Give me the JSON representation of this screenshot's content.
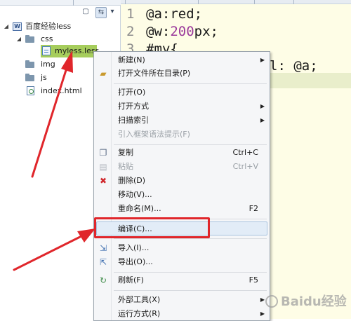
{
  "project_tree": {
    "project": "百度经验less",
    "css_folder": "css",
    "selected_file": "myless.less",
    "img_folder": "img",
    "js_folder": "js",
    "index_file": "index.html"
  },
  "editor": {
    "lines": [
      {
        "num": "1",
        "text": "@a:red;"
      },
      {
        "num": "2",
        "text_pre": "@w:",
        "text_num": "200",
        "text_post": "px;"
      },
      {
        "num": "3",
        "text": "#my{"
      },
      {
        "partial": "l: @a;"
      }
    ]
  },
  "context_menu": {
    "items": [
      {
        "label": "新建(N)",
        "shortcut": "",
        "submenu": true,
        "icon": ""
      },
      {
        "label": "打开文件所在目录(P)",
        "shortcut": "",
        "submenu": false,
        "icon": "folder-open-icon"
      },
      {
        "label": "打开(O)",
        "shortcut": "",
        "submenu": false,
        "icon": ""
      },
      {
        "label": "打开方式",
        "shortcut": "",
        "submenu": true,
        "icon": ""
      },
      {
        "label": "扫描索引",
        "shortcut": "",
        "submenu": true,
        "icon": ""
      },
      {
        "label": "引入框架语法提示(F)",
        "shortcut": "",
        "submenu": false,
        "icon": "",
        "disabled": true
      },
      {
        "label": "复制",
        "shortcut": "Ctrl+C",
        "submenu": false,
        "icon": "copy-icon"
      },
      {
        "label": "粘贴",
        "shortcut": "Ctrl+V",
        "submenu": false,
        "icon": "paste-icon",
        "disabled": true
      },
      {
        "label": "删除(D)",
        "shortcut": "",
        "submenu": false,
        "icon": "delete-icon"
      },
      {
        "label": "移动(V)...",
        "shortcut": "",
        "submenu": false,
        "icon": ""
      },
      {
        "label": "重命名(M)...",
        "shortcut": "F2",
        "submenu": false,
        "icon": ""
      },
      {
        "label": "编译(C)...",
        "shortcut": "",
        "submenu": false,
        "icon": ""
      },
      {
        "label": "导入(I)...",
        "shortcut": "",
        "submenu": false,
        "icon": "import-icon"
      },
      {
        "label": "导出(O)...",
        "shortcut": "",
        "submenu": false,
        "icon": "export-icon"
      },
      {
        "label": "刷新(F)",
        "shortcut": "F5",
        "submenu": false,
        "icon": "refresh-icon"
      },
      {
        "label": "外部工具(X)",
        "shortcut": "",
        "submenu": true,
        "icon": ""
      },
      {
        "label": "运行方式(R)",
        "shortcut": "",
        "submenu": true,
        "icon": ""
      }
    ]
  },
  "watermark": "Baidu经验",
  "colors": {
    "selection": "#a6cd5c",
    "highlight_box": "#e0262b",
    "editor_bg": "#fefde6"
  }
}
